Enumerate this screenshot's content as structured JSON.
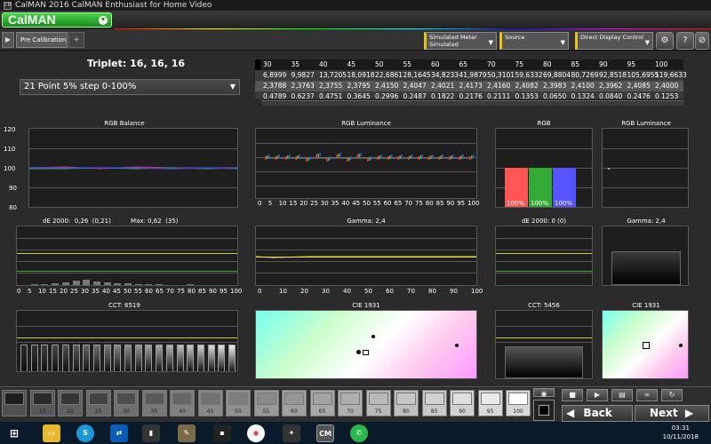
{
  "window": {
    "title": "CalMAN 2016 CalMAN Enthusiast for Home Video",
    "app_icon": "CM"
  },
  "header": {
    "logo": "CalMAN",
    "logo_dropdown_icon": "chevron-down-icon"
  },
  "toolbar": {
    "tab_label": "Pre Calibration",
    "tab_add": "+",
    "meter_dropdown": "Simulated Meter\nSimulated",
    "source_dropdown": "Source",
    "display_dropdown": "Direct Display Control",
    "settings_icon": "gear-icon",
    "help_icon": "help-icon",
    "close_icon": "close-icon"
  },
  "main": {
    "triplet": "Triplet: 16, 16, 16",
    "point_select": "21 Point 5% step 0-100%"
  },
  "table": {
    "headers": [
      "30",
      "35",
      "40",
      "45",
      "50",
      "55",
      "60",
      "65",
      "70",
      "75",
      "80",
      "85",
      "90",
      "95",
      "100"
    ],
    "row1": [
      "6,8999",
      "9,9827",
      "13,7205",
      "18,0918",
      "22,6861",
      "28,1645",
      "34,8233",
      "41,9879",
      "50,3101",
      "59,6332",
      "69,8804",
      "80,7269",
      "92,8518",
      "105,6955",
      "119,6633"
    ],
    "row2": [
      "2,3788",
      "2,3763",
      "2,3755",
      "2,3795",
      "2,4150",
      "2,4047",
      "2,4021",
      "2,4173",
      "2,4160",
      "2,4082",
      "2,3983",
      "2,4100",
      "2,3962",
      "2,4085",
      "2,4000"
    ],
    "row3": [
      "0,4789",
      "0,6237",
      "0,4751",
      "0,3645",
      "0,2996",
      "0,2487",
      "0,1822",
      "0,2176",
      "0,2111",
      "0,1353",
      "0,0650",
      "0,1324",
      "0,0840",
      "0,2476",
      "0,1253"
    ]
  },
  "panels": {
    "rgb_balance": {
      "title": "RGB Balance",
      "y_ticks": [
        "120",
        "110",
        "100",
        "90",
        "80"
      ]
    },
    "rgb_luminance": {
      "title": "RGB Luminance",
      "x_ticks": [
        "0",
        "5",
        "10",
        "15",
        "20",
        "25",
        "30",
        "35",
        "40",
        "45",
        "50",
        "55",
        "60",
        "65",
        "70",
        "75",
        "80",
        "85",
        "90",
        "95",
        "100"
      ]
    },
    "rgb": {
      "title": "RGB",
      "bars": [
        "100%",
        "100%",
        "100%"
      ]
    },
    "rgb_luminance_small": {
      "title": "RGB Luminance"
    },
    "de2000": {
      "title": "dE 2000:  0,26  (0,21)          Max: 0,62  (35)",
      "x_ticks": [
        "0",
        "5",
        "10",
        "15",
        "20",
        "25",
        "30",
        "35",
        "40",
        "45",
        "50",
        "55",
        "60",
        "65",
        "70",
        "75",
        "80",
        "85",
        "90",
        "95",
        "100"
      ]
    },
    "gamma": {
      "title": "Gamma: 2,4",
      "x_ticks": [
        "0",
        "10",
        "20",
        "30",
        "40",
        "50",
        "60",
        "70",
        "80",
        "90",
        "100"
      ]
    },
    "de2000_small": {
      "title": "dE 2000: 0 (0)"
    },
    "gamma_small": {
      "title": "Gamma: 2,4"
    },
    "cct": {
      "title": "CCT: 6519"
    },
    "cie": {
      "title": "CIE 1931"
    },
    "cct_small": {
      "title": "CCT: 5456"
    },
    "cie_small": {
      "title": "CIE 1931"
    }
  },
  "swatches": {
    "labels": [
      "",
      "15",
      "20",
      "25",
      "30",
      "35",
      "40",
      "45",
      "50",
      "55",
      "60",
      "65",
      "70",
      "75",
      "80",
      "85",
      "90",
      "95",
      "100"
    ]
  },
  "nav": {
    "back": "Back",
    "next": "Next"
  },
  "taskbar": {
    "time": "03:31",
    "date": "10/11/2018"
  }
}
